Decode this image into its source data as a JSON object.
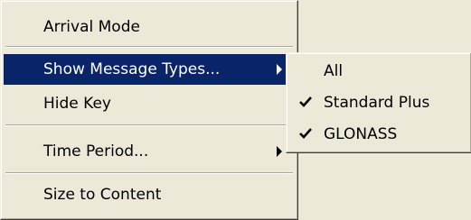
{
  "context_menu": {
    "items": [
      {
        "label": "Arrival Mode"
      },
      {
        "label": "Show Message Types..."
      },
      {
        "label": "Hide Key"
      },
      {
        "label": "Time Period..."
      },
      {
        "label": "Size to Content"
      }
    ]
  },
  "submenu": {
    "items": [
      {
        "label": "All",
        "checked": false
      },
      {
        "label": "Standard Plus",
        "checked": true
      },
      {
        "label": "GLONASS",
        "checked": true
      }
    ]
  },
  "colors": {
    "menu_bg": "#ECE9D8",
    "highlight": "#0A246A",
    "highlight_text": "#FFFFFF"
  },
  "icons": {
    "submenu_arrow": "chevron-right-icon",
    "check": "checkmark-icon"
  }
}
